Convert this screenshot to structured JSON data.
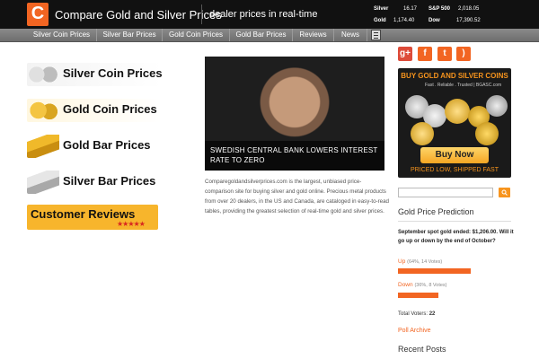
{
  "header": {
    "logo_letter": "C",
    "site_title": "Compare Gold and Silver Prices",
    "tagline": "dealer prices in real-time"
  },
  "ticker": [
    {
      "label": "Silver",
      "value": "16.17"
    },
    {
      "label": "S&P 500",
      "value": "2,018.05"
    },
    {
      "label": "Gold",
      "value": "1,174.40"
    },
    {
      "label": "Dow",
      "value": "17,390.52"
    }
  ],
  "nav": {
    "items": [
      "Silver Coin Prices",
      "Silver Bar Prices",
      "Gold Coin Prices",
      "Gold Bar Prices",
      "Reviews",
      "News"
    ],
    "calculator_icon": "calculator-icon"
  },
  "promos": [
    {
      "label": "Silver Coin Prices",
      "icon": "silver-coins-image"
    },
    {
      "label": "Gold Coin Prices",
      "icon": "gold-coins-image"
    },
    {
      "label": "Gold Bar Prices",
      "icon": "gold-bars-image"
    },
    {
      "label": "Silver Bar Prices",
      "icon": "silver-bars-image"
    },
    {
      "label": "Customer Reviews",
      "icon": "stars-icon",
      "rating_stars": 5
    }
  ],
  "featured": {
    "caption": "SWEDISH CENTRAL BANK LOWERS INTEREST RATE TO ZERO",
    "description": "Comparegoldandsilverprices.com is the largest, unbiased price-comparison site for buying silver and gold online. Precious metal products from over 20 dealers, in the US and Canada, are cataloged in easy-to-read tables, providing the greatest selection of real-time gold and silver prices."
  },
  "social": [
    {
      "name": "google-plus-icon",
      "glyph": "g+",
      "color": "#dd4b39"
    },
    {
      "name": "facebook-icon",
      "glyph": "f",
      "color": "#f26522"
    },
    {
      "name": "twitter-icon",
      "glyph": "t",
      "color": "#f26522"
    },
    {
      "name": "rss-icon",
      "glyph": ")",
      "color": "#f26522"
    }
  ],
  "ad": {
    "headline": "BUY GOLD AND SILVER COINS",
    "sub": "Fast . Reliable . Trusted | BGASC.com",
    "cta": "Buy Now",
    "footer": "PRICED LOW, SHIPPED FAST"
  },
  "search": {
    "placeholder": ""
  },
  "poll": {
    "title": "Gold Price Prediction",
    "question": "September spot gold ended: $1,206.00. Will it go up or down by the end of October?",
    "options": [
      {
        "label": "Up",
        "detail": "(64%, 14 Votes)",
        "percent": 64
      },
      {
        "label": "Down",
        "detail": "(36%, 8 Votes)",
        "percent": 36
      }
    ],
    "voters_label": "Total Voters:",
    "voters_count": "22",
    "archive_label": "Poll Archive"
  },
  "recent_posts": {
    "title": "Recent Posts"
  },
  "colors": {
    "accent": "#f26522",
    "header_bg": "#111111",
    "nav_bg": "#7a7a7a"
  }
}
